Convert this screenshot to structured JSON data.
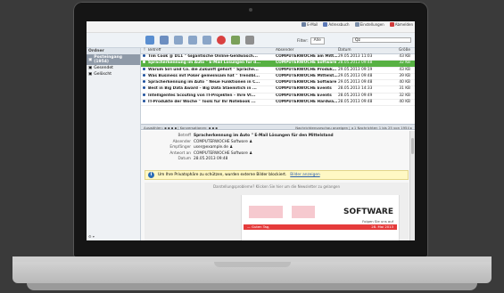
{
  "toplinks": [
    {
      "label": "E-Mail",
      "color": "#6a7fa0"
    },
    {
      "label": "Adressbuch",
      "color": "#5b78b6"
    },
    {
      "label": "Einstellungen",
      "color": "#7b8ea8"
    },
    {
      "label": "Abmelden",
      "color": "#d23b3b"
    }
  ],
  "filter": {
    "label": "Filter:",
    "value": "Alle",
    "search_placeholder": "Qz"
  },
  "sidebar": {
    "header": "Ordner",
    "items": [
      {
        "label": "Posteingang (1954)",
        "active": true
      },
      {
        "label": "Gesendet",
        "active": false
      },
      {
        "label": "Gelöscht",
        "active": false
      }
    ],
    "footer": "⚙ ▾"
  },
  "list": {
    "columns": {
      "flag": "!",
      "subject": "Betreff",
      "from": "Absender",
      "date": "Datum",
      "size": "Größe"
    },
    "rows": [
      {
        "subject": "Tim Cook @ D11 \" Gigantische Online-Geldwäsch...",
        "from": "COMPUTERWOCHE am Mittag",
        "date": "29.05.2013 11:03",
        "size": "43 KB",
        "sel": false
      },
      {
        "subject": "Spracherkennung im Auto \" E-Mail Lösungen für d...",
        "from": "COMPUTERWOCHE Software",
        "date": "28.05.2013 09:48",
        "size": "32 KB",
        "sel": true
      },
      {
        "subject": "Warum Siri und Co. die Zukunft gehört \" Sprache...",
        "from": "COMPUTERWOCHE Produkt...",
        "date": "29.05.2013 09:19",
        "size": "43 KB",
        "sel": false
      },
      {
        "subject": "Was Business mit Poker gemeinsam hat \" Trendbl...",
        "from": "COMPUTERWOCHE Mittelst...",
        "date": "29.05.2013 09:48",
        "size": "39 KB",
        "sel": false
      },
      {
        "subject": "Spracherkennung im Auto \" Neue Funktionen in C...",
        "from": "COMPUTERWOCHE Software",
        "date": "29.05.2013 09:48",
        "size": "40 KB",
        "sel": false
      },
      {
        "subject": "Best in Big Data Award – Big Data Staemitich in ...",
        "from": "COMPUTERWOCHE Events",
        "date": "28.05.2013 14:33",
        "size": "31 KB",
        "sel": false
      },
      {
        "subject": "Intelligentes Scouting von IT-Projekten – Ihre VI...",
        "from": "COMPUTERWOCHE Events",
        "date": "28.05.2013 09:49",
        "size": "32 KB",
        "sel": false
      },
      {
        "subject": "IT-Produkte der Woche \" Tools für Ihr Notebook ...",
        "from": "COMPUTERWOCHE Hardware",
        "date": "28.05.2013 09:48",
        "size": "40 KB",
        "sel": false
      }
    ]
  },
  "divider": {
    "left": "Auswählen: ▪ ▪ ▪ ▪ | Konversationen: ▪ ▪ ▪",
    "right": "Nachrichtenvorschau anzeigen | ◂ 1 Nachrichten 1 bis 25 von 1954 ▸"
  },
  "preview": {
    "labels": {
      "subject": "Betreff",
      "from": "Absender",
      "to": "Empfänger",
      "reply": "Antwort an",
      "date": "Datum"
    },
    "subject": "Spracherkennung im Auto \" E-Mail Lösungen für den Mittelstand",
    "from": "COMPUTERWOCHE Software ♟",
    "to": "user@example.de ♟",
    "reply": "COMPUTERWOCHE Software ♟",
    "date": "28.05.2013 09:48",
    "info_text": "Um Ihre Privatsphäre zu schützen, wurden externe Bilder blockiert.",
    "info_link": "Bilder anzeigen",
    "mail_top": "Darstellungsprobleme? Klicken Sie hier um die Newsletter zu gelangen",
    "brand": "SOFTWARE",
    "brand_sub": "Folgen Sie uns auf",
    "bar_left": "— Guten Tag,",
    "bar_right": "28. Mai 2013"
  }
}
